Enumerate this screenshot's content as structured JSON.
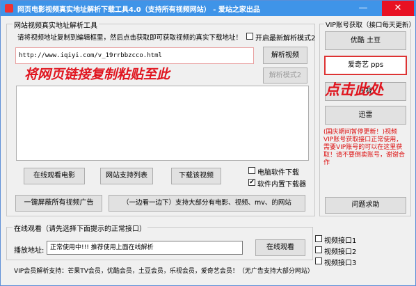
{
  "window": {
    "title": "网页电影视频真实地址解析下载工具4.0（支持所有视频网站） - 爱站之家出品",
    "min_glyph": "—",
    "close_glyph": "✕"
  },
  "parse_group": {
    "legend": "网站视频真实地址解析工具",
    "instruction": "请将视频地址复制到编辑框里，然后点击获取即可获取视频的真实下载地址！",
    "new_mode_label": "开启最新解析模式2",
    "url_value": "http://www.iqiyi.com/v_19rrbbzcco.html",
    "parse_button": "解析视频",
    "mode2_button": "解析模式2",
    "result_text": "",
    "online_button": "在线观看电影",
    "sites_button": "网站支持列表",
    "download_button": "下载该视频",
    "pc_download_label": "电脑软件下载",
    "builtin_downloader_label": "软件内置下载器",
    "block_ads_button": "一键屏蔽所有视频广告",
    "side_by_side_button": "（一边看一边下）支持大部分有电影、视频、mv、的网站"
  },
  "vip_group": {
    "legend": "VIP账号获取（接口每天更新）",
    "youku_button": "优酷 土豆",
    "iqiyi_button": "爱奇艺 pps",
    "letv_button": "乐视",
    "xunlei_button": "迅雷",
    "notice": "(国庆期间暂停更新！)视频VIP账号获取接口正常使用，需要VIP账号的可以在这里获取！请不要倒卖账号，谢谢合作",
    "help_button": "问题求助"
  },
  "watch_group": {
    "legend": "在线观看（请先选择下面提示的正常接口）",
    "addr_label": "播放地址:",
    "addr_value": "正常使用中!!! 推荐使用上面在线解析",
    "watch_button": "在线观看",
    "iface1": "视频接口1",
    "iface2": "视频接口2",
    "iface3": "视频接口3"
  },
  "footer": {
    "text": "VIP会员解析支持：芒果TV会员，优酷会员，土豆会员，乐视会员，爱奇艺会员！（无广告支持大部分网站）"
  },
  "annotations": {
    "paste_hint": "将网页链接复制粘贴至此",
    "click_hint": "点击此处"
  },
  "checks": {
    "builtin_checked": "✔"
  },
  "colors": {
    "titlebar": "#3f94e8",
    "annotation": "#e0141e"
  }
}
